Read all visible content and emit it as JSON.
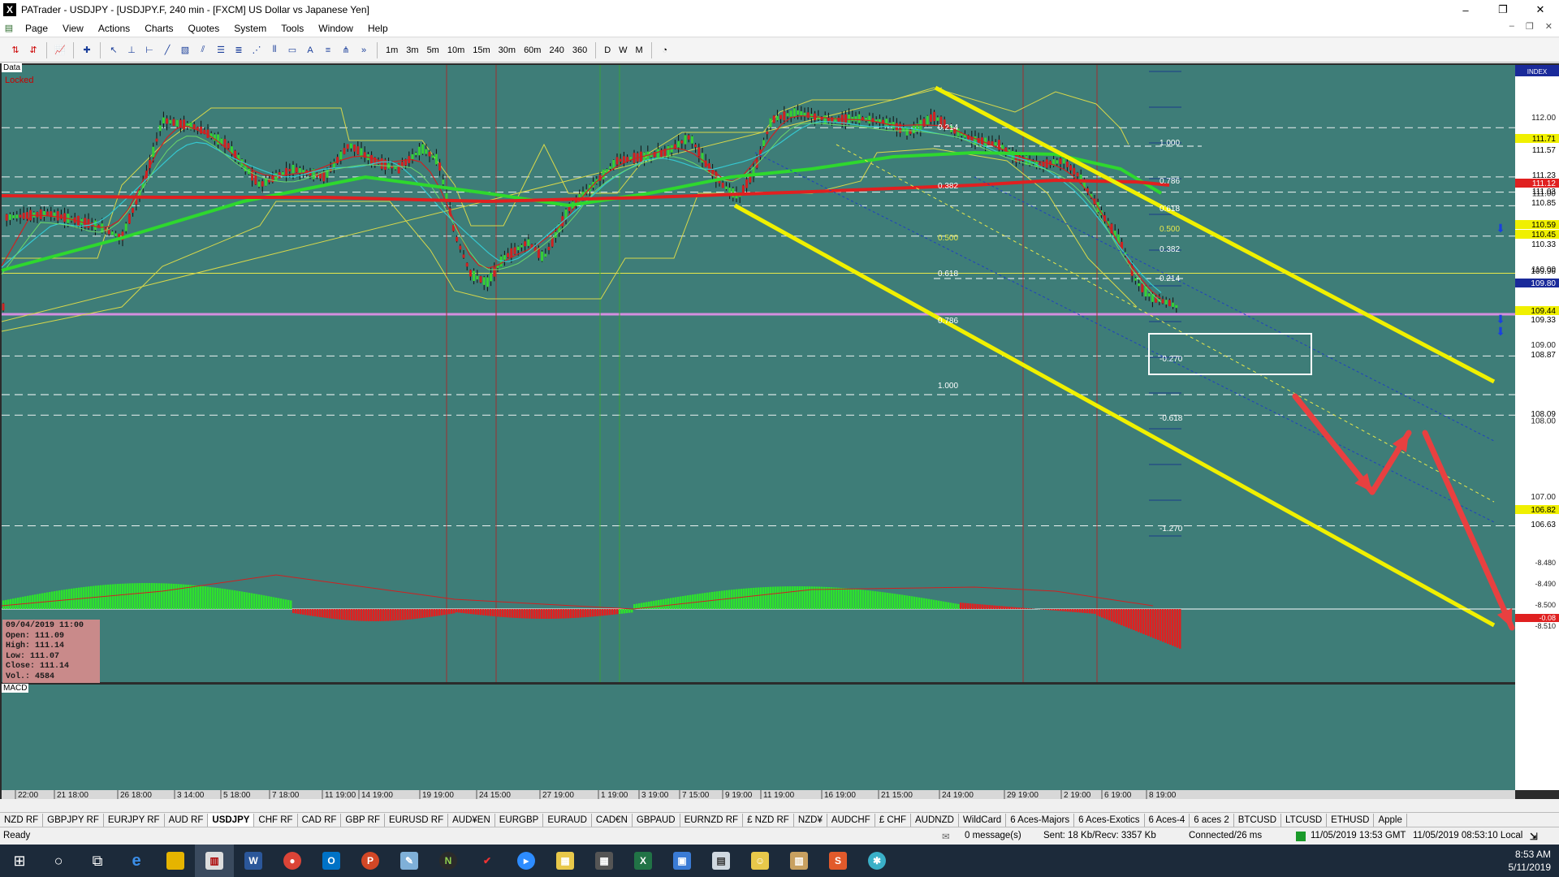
{
  "window": {
    "title": "PATrader - USDJPY - [USDJPY.F, 240 min - [FXCM] US Dollar vs Japanese Yen]",
    "app_icon": "X",
    "controls": [
      "–",
      "❐",
      "✕"
    ]
  },
  "menu": {
    "items": [
      "Page",
      "View",
      "Actions",
      "Charts",
      "Quotes",
      "System",
      "Tools",
      "Window",
      "Help"
    ],
    "mdi_controls": [
      "–",
      "❐",
      "✕"
    ]
  },
  "toolbar": {
    "timeframes": [
      "1m",
      "3m",
      "5m",
      "10m",
      "15m",
      "30m",
      "60m",
      "240",
      "360"
    ],
    "periods": [
      "D",
      "W",
      "M"
    ]
  },
  "chart": {
    "data_label": "Data",
    "locked_label": "Locked",
    "index_label": "INDEX",
    "bg_color": "#3e7d78",
    "price_scale": [
      "112.00",
      "111.00",
      "110.00",
      "109.00",
      "108.00",
      "107.00"
    ],
    "price_markers": [
      "111.71",
      "111.57",
      "111.23",
      "111.12",
      "111.03",
      "110.85",
      "110.59",
      "110.45",
      "110.33",
      "109.96",
      "109.80",
      "109.44",
      "109.33",
      "108.87",
      "108.09",
      "106.82",
      "106.63"
    ],
    "fib_left": [
      "0.214",
      "0.382",
      "0.500",
      "0.618",
      "0.786",
      "1.000"
    ],
    "fib_right": [
      "1.000",
      "0.786",
      "0.618",
      "0.500",
      "0.382",
      "0.214",
      "-0.270",
      "-0.618",
      "-1.270"
    ],
    "time_axis": [
      "22:00",
      "21 18:00",
      "26 18:00",
      "3 14:00",
      "5 18:00",
      "7 18:00",
      "11 19:00",
      "14 19:00",
      "19 19:00",
      "24 15:00",
      "27 19:00",
      "1 19:00",
      "3 19:00",
      "7 15:00",
      "9 19:00",
      "11 19:00",
      "16 19:00",
      "21 15:00",
      "24 19:00",
      "29 19:00",
      "2 19:00",
      "6 19:00",
      "8 19:00"
    ],
    "info_box": {
      "date": "09/04/2019 11:00",
      "open": "Open: 111.09",
      "high": "High: 111.14",
      "low": "Low: 111.07",
      "close": "Close: 111.14",
      "vol": "Vol.: 4584"
    },
    "macd_label": "MACD",
    "macd_scale": [
      "-8.480",
      "-8.490",
      "-8.500",
      "-8.510"
    ],
    "macd_markers": [
      "-0.08"
    ]
  },
  "tabs": [
    "NZD RF",
    "GBPJPY RF",
    "EURJPY RF",
    "AUD RF",
    "USDJPY",
    "CHF RF",
    "CAD RF",
    "GBP RF",
    "EURUSD RF",
    "AUD¥EN",
    "EURGBP",
    "EURAUD",
    "CAD€N",
    "GBPAUD",
    "EURNZD RF",
    "£ NZD RF",
    "NZD¥",
    "AUDCHF",
    "£ CHF",
    "AUDNZD",
    "WildCard",
    "6 Aces-Majors",
    "6 Aces-Exotics",
    "6 Aces-4",
    "6 aces 2",
    "BTCUSD",
    "LTCUSD",
    "ETHUSD",
    "Apple"
  ],
  "active_tab": "USDJPY",
  "status": {
    "ready": "Ready",
    "messages": "0 message(s)",
    "traffic": "Sent: 18 Kb/Recv: 3357 Kb",
    "connection": "Connected/26 ms",
    "gmt": "11/05/2019 13:53 GMT",
    "local": "11/05/2019 08:53:10 Local"
  },
  "taskbar": {
    "time": "8:53 AM",
    "date": "5/11/2019",
    "apps": [
      "start",
      "search",
      "task-view",
      "edge",
      "explorer",
      "patrader",
      "word",
      "chrome",
      "outlook",
      "powerpoint",
      "notes",
      "ninja",
      "trading",
      "zoom",
      "files",
      "calculator",
      "excel",
      "remote",
      "calendar",
      "contacts",
      "book",
      "snagit",
      "app"
    ]
  }
}
